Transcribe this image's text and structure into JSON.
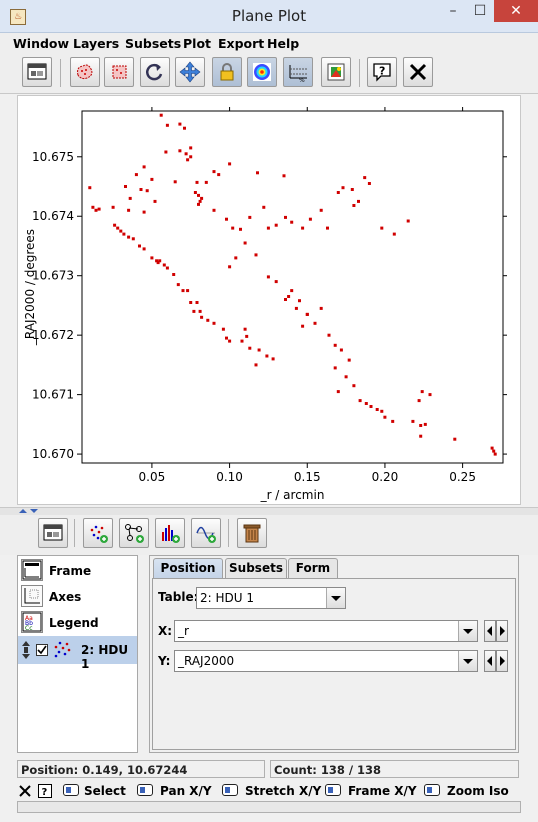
{
  "window": {
    "title": "Plane Plot",
    "min": "–",
    "max": "☐",
    "close": "✕"
  },
  "menu": [
    "Window",
    "Layers",
    "Subsets",
    "Plot",
    "Export",
    "Help"
  ],
  "toolbar_help_glyph": "?",
  "toolbar_close_glyph": "✕",
  "layers": {
    "items": [
      {
        "label": "Frame"
      },
      {
        "label": "Axes"
      },
      {
        "label": "Legend"
      },
      {
        "label": "2: HDU 1",
        "checked": true
      }
    ]
  },
  "config": {
    "tabs": [
      "Position",
      "Subsets",
      "Form"
    ],
    "table_label": "Table:",
    "table_value": "2: HDU 1",
    "x_label": "X:",
    "x_value": "_r",
    "y_label": "Y:",
    "y_value": "_RAJ2000"
  },
  "status": {
    "position": "Position: 0.149, 10.67244",
    "count": "Count: 138 / 138"
  },
  "hints": {
    "select": "Select",
    "pan": "Pan X/Y",
    "stretch": "Stretch X/Y",
    "frame": "Frame X/Y",
    "zoom": "Zoom Iso"
  },
  "colors": {
    "points": "#d00000",
    "accent": "#3a62b8"
  },
  "chart_data": {
    "type": "scatter",
    "xlabel": "_r / arcmin",
    "ylabel": "_RAJ2000 / degrees",
    "xlim": [
      0.005,
      0.276
    ],
    "ylim": [
      10.66985,
      10.67577
    ],
    "xticks": [
      0.05,
      0.1,
      0.15,
      0.2,
      0.25
    ],
    "xtick_labels": [
      "0.05",
      "0.10",
      "0.15",
      "0.20",
      "0.25"
    ],
    "yticks": [
      10.67,
      10.671,
      10.672,
      10.673,
      10.674,
      10.675
    ],
    "ytick_labels": [
      "10.670",
      "10.671",
      "10.672",
      "10.673",
      "10.674",
      "10.675"
    ],
    "x": [
      0.056,
      0.06,
      0.068,
      0.071,
      0.075,
      0.068,
      0.073,
      0.075,
      0.045,
      0.059,
      0.072,
      0.09,
      0.04,
      0.05,
      0.065,
      0.079,
      0.085,
      0.093,
      0.1,
      0.118,
      0.135,
      0.047,
      0.043,
      0.036,
      0.033,
      0.01,
      0.012,
      0.014,
      0.016,
      0.025,
      0.035,
      0.045,
      0.052,
      0.078,
      0.08,
      0.08,
      0.082,
      0.081,
      0.09,
      0.098,
      0.102,
      0.107,
      0.113,
      0.122,
      0.125,
      0.13,
      0.136,
      0.14,
      0.147,
      0.152,
      0.159,
      0.163,
      0.17,
      0.173,
      0.179,
      0.18,
      0.183,
      0.187,
      0.19,
      0.198,
      0.206,
      0.215,
      0.026,
      0.028,
      0.03,
      0.032,
      0.035,
      0.038,
      0.042,
      0.045,
      0.05,
      0.053,
      0.054,
      0.055,
      0.058,
      0.06,
      0.064,
      0.067,
      0.07,
      0.073,
      0.075,
      0.077,
      0.079,
      0.081,
      0.082,
      0.086,
      0.09,
      0.096,
      0.098,
      0.1,
      0.108,
      0.11,
      0.111,
      0.113,
      0.119,
      0.124,
      0.128,
      0.117,
      0.1,
      0.104,
      0.11,
      0.117,
      0.125,
      0.13,
      0.143,
      0.138,
      0.136,
      0.14,
      0.15,
      0.155,
      0.159,
      0.15,
      0.145,
      0.147,
      0.164,
      0.168,
      0.172,
      0.177,
      0.168,
      0.175,
      0.18,
      0.17,
      0.184,
      0.188,
      0.191,
      0.195,
      0.198,
      0.2,
      0.205,
      0.218,
      0.223,
      0.223,
      0.224,
      0.229,
      0.222,
      0.226,
      0.245,
      0.269,
      0.27,
      0.271
    ],
    "y": [
      10.6757,
      10.67553,
      10.67555,
      10.67548,
      10.67515,
      10.6751,
      10.67495,
      10.675,
      10.67483,
      10.67508,
      10.67505,
      10.67475,
      10.6747,
      10.67462,
      10.67458,
      10.67457,
      10.67457,
      10.6747,
      10.67488,
      10.67473,
      10.67468,
      10.67443,
      10.67445,
      10.6743,
      10.6745,
      10.67448,
      10.67415,
      10.6741,
      10.67412,
      10.67415,
      10.6741,
      10.67407,
      10.67425,
      10.6744,
      10.67435,
      10.6742,
      10.6743,
      10.67425,
      10.6741,
      10.67395,
      10.6738,
      10.67378,
      10.67398,
      10.67415,
      10.6738,
      10.67385,
      10.67398,
      10.6739,
      10.6738,
      10.67395,
      10.6741,
      10.6738,
      10.6744,
      10.67448,
      10.67445,
      10.67418,
      10.67425,
      10.67465,
      10.67455,
      10.6738,
      10.6737,
      10.67392,
      10.67385,
      10.6738,
      10.67375,
      10.6737,
      10.67365,
      10.67362,
      10.6735,
      10.67345,
      10.6733,
      10.67325,
      10.67322,
      10.67325,
      10.67318,
      10.67313,
      10.67302,
      10.67285,
      10.67275,
      10.67275,
      10.67255,
      10.6724,
      10.67255,
      10.6724,
      10.6723,
      10.67225,
      10.6722,
      10.6721,
      10.67195,
      10.6719,
      10.6719,
      10.6721,
      10.67198,
      10.67178,
      10.67175,
      10.67165,
      10.6716,
      10.6715,
      10.67315,
      10.6733,
      10.67355,
      10.67335,
      10.67298,
      10.6729,
      10.67245,
      10.67265,
      10.6726,
      10.67275,
      10.67235,
      10.6722,
      10.67245,
      10.67235,
      10.67258,
      10.67215,
      10.672,
      10.67183,
      10.67175,
      10.67158,
      10.67145,
      10.6713,
      10.67115,
      10.67105,
      10.6709,
      10.67085,
      10.6708,
      10.67075,
      10.67072,
      10.67062,
      10.67055,
      10.67055,
      10.67048,
      10.6703,
      10.67105,
      10.671,
      10.6709,
      10.6705,
      10.67025,
      10.6701,
      10.67005,
      10.67,
      10.67,
      10.66995
    ]
  }
}
